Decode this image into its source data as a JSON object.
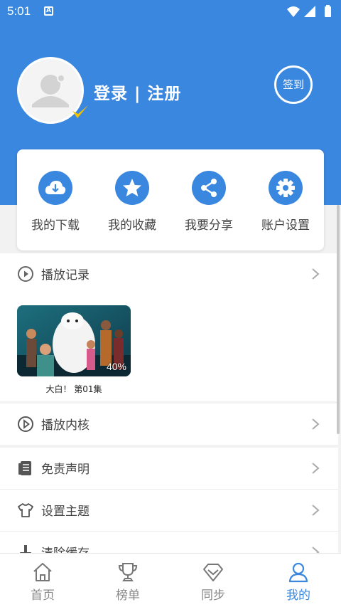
{
  "status_bar": {
    "time": "5:01",
    "app_icon_letter": "A"
  },
  "header": {
    "login_text": "登录 | 注册",
    "checkin_label": "签到"
  },
  "quick_actions": [
    {
      "label": "我的下载",
      "icon": "download-cloud-icon"
    },
    {
      "label": "我的收藏",
      "icon": "star-icon"
    },
    {
      "label": "我要分享",
      "icon": "share-icon"
    },
    {
      "label": "账户设置",
      "icon": "gear-icon"
    }
  ],
  "history": {
    "title": "播放记录",
    "items": [
      {
        "caption": "大白！ 第01集",
        "progress": "40%"
      }
    ]
  },
  "menu": [
    {
      "label": "播放内核",
      "icon": "play-circle-icon"
    },
    {
      "label": "免责声明",
      "icon": "document-icon"
    },
    {
      "label": "设置主题",
      "icon": "tshirt-icon"
    },
    {
      "label": "清除缓存",
      "icon": "broom-icon"
    }
  ],
  "bottom_nav": [
    {
      "label": "首页",
      "icon": "home-icon",
      "active": false
    },
    {
      "label": "榜单",
      "icon": "trophy-icon",
      "active": false
    },
    {
      "label": "同步",
      "icon": "diamond-icon",
      "active": false
    },
    {
      "label": "我的",
      "icon": "user-icon",
      "active": true
    }
  ],
  "colors": {
    "accent": "#3a87e0",
    "background": "#f2f2f2"
  }
}
